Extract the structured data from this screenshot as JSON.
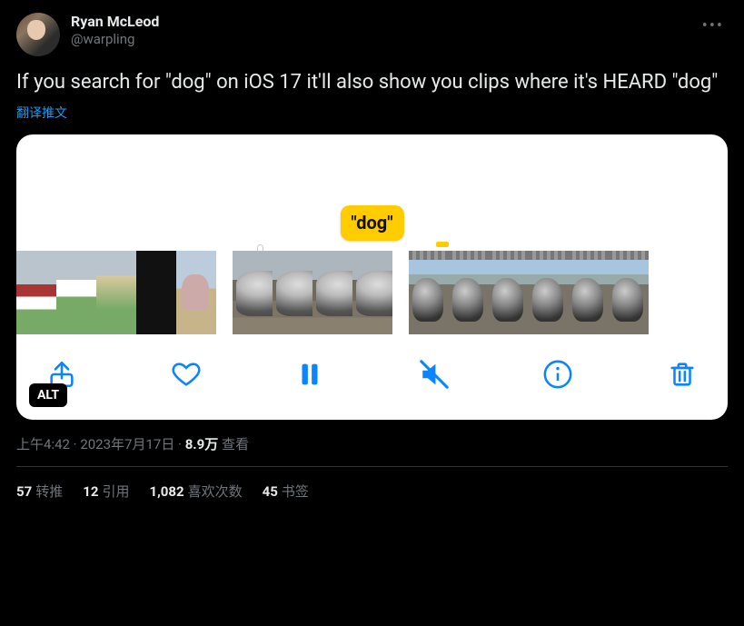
{
  "author": {
    "display_name": "Ryan McLeod",
    "handle": "@warpling"
  },
  "tweet_text": "If you search for \"dog\" on iOS 17 it'll also show you clips where it's HEARD \"dog\"",
  "translate_label": "翻译推文",
  "media": {
    "caption_bubble": "\"dog\"",
    "alt_badge": "ALT",
    "toolbar_icons": {
      "share": "share-icon",
      "like": "heart-icon",
      "pause": "pause-icon",
      "mute": "speaker-muted-icon",
      "info": "info-icon",
      "trash": "trash-icon"
    }
  },
  "meta": {
    "time": "上午4:42",
    "separator": " · ",
    "date": "2023年7月17日",
    "views_number": "8.9万",
    "views_label": " 查看"
  },
  "stats": {
    "retweets": {
      "count": "57",
      "label": "转推"
    },
    "quotes": {
      "count": "12",
      "label": "引用"
    },
    "likes": {
      "count": "1,082",
      "label": "喜欢次数"
    },
    "bookmarks": {
      "count": "45",
      "label": "书签"
    }
  }
}
